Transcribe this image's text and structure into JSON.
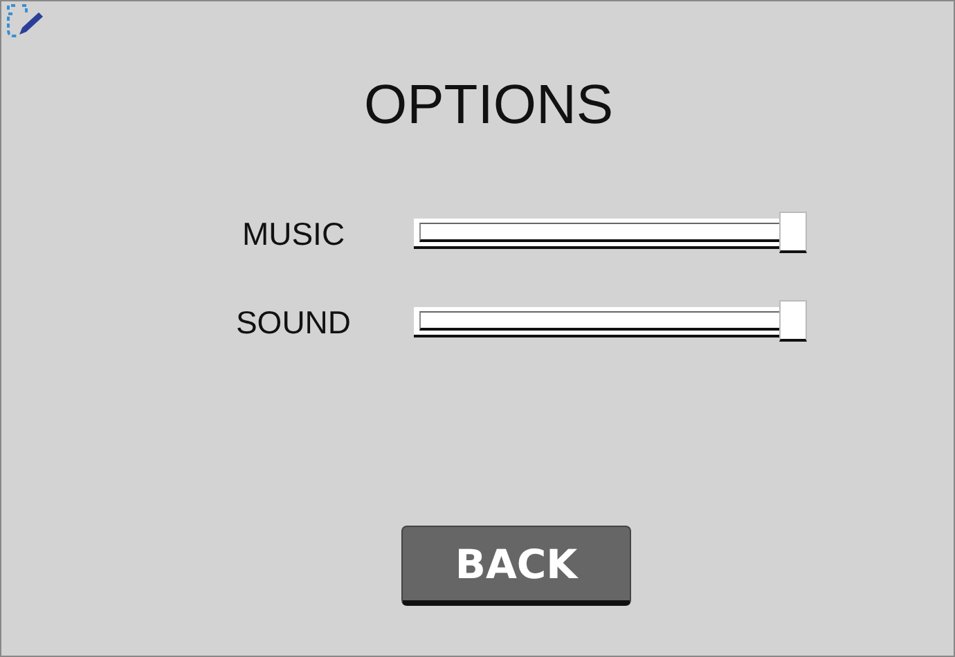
{
  "title": "OPTIONS",
  "settings": [
    {
      "label": "MUSIC",
      "level": 1
    },
    {
      "label": "SOUND",
      "level": 1
    }
  ],
  "back_button": "BACK"
}
